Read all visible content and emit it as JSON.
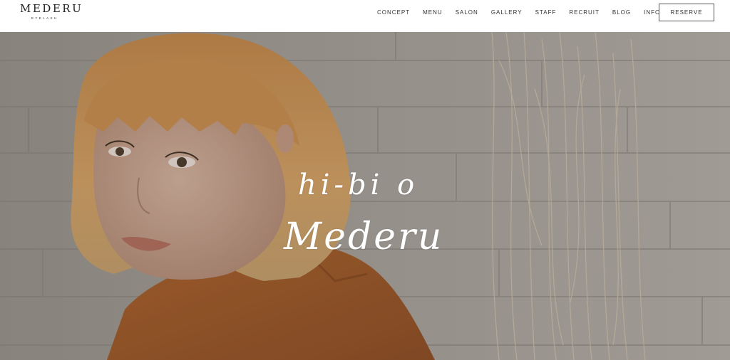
{
  "brand": {
    "name": "MEDERU",
    "sub": "EYELASH"
  },
  "nav": {
    "items": [
      {
        "label": "CONCEPT"
      },
      {
        "label": "MENU"
      },
      {
        "label": "SALON"
      },
      {
        "label": "GALLERY"
      },
      {
        "label": "STAFF"
      },
      {
        "label": "RECRUIT"
      },
      {
        "label": "BLOG"
      },
      {
        "label": "INFO"
      }
    ],
    "reserve_label": "RESERVE"
  },
  "hero": {
    "line1": "hi-bi o",
    "line2": "Mederu"
  },
  "colors": {
    "header_bg": "#ffffff",
    "hero_overlay": "#7d7872",
    "shirt": "#b8672e",
    "hair": "#d9a15c",
    "tagline": "#ffffff"
  }
}
